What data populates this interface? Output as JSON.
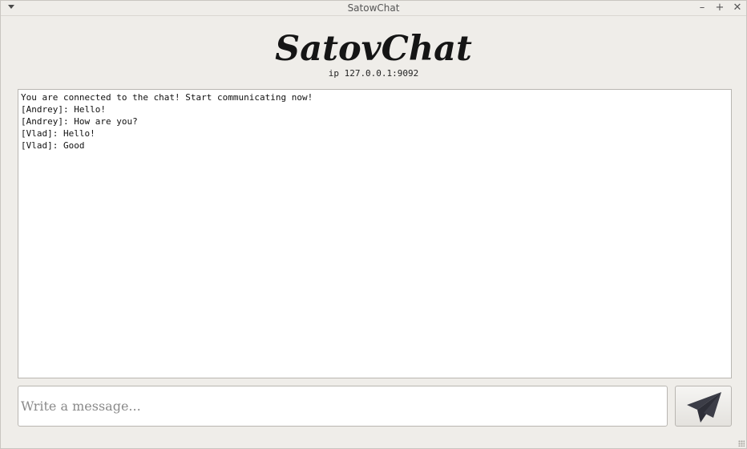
{
  "window": {
    "title": "SatowChat",
    "controls": {
      "minimize": "–",
      "maximize": "+",
      "close": "✕"
    }
  },
  "header": {
    "logo": "SatovChat",
    "ip": "ip 127.0.0.1:9092"
  },
  "chat": {
    "lines": [
      "You are connected to the chat! Start communicating now!",
      "[Andrey]: Hello!",
      "[Andrey]: How are you?",
      "[Vlad]: Hello!",
      "[Vlad]: Good"
    ]
  },
  "composer": {
    "placeholder": "Write a message...",
    "value": "",
    "send_icon": "paper-plane-icon"
  },
  "colors": {
    "background": "#efede9",
    "logo_text": "#151515",
    "icon": "#3c3d47"
  }
}
